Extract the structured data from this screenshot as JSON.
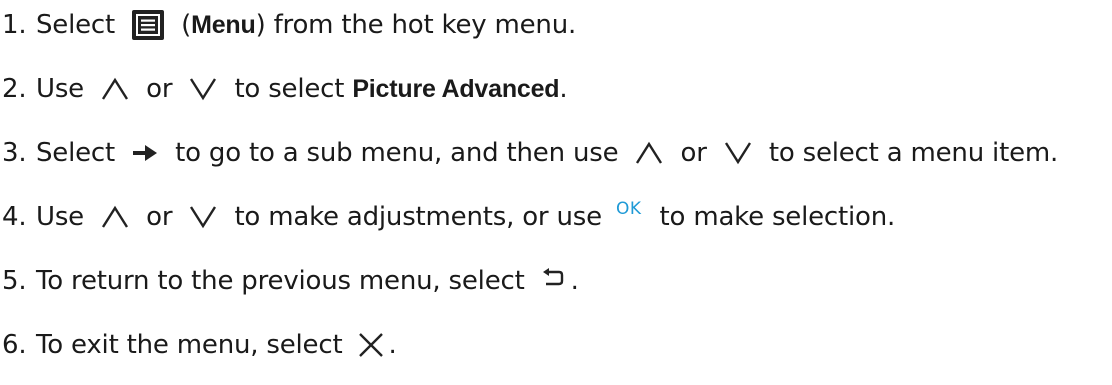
{
  "steps": [
    {
      "number": "1.",
      "parts": {
        "a": "Select ",
        "icon1": "menu-icon",
        "b": " (",
        "bold": "Menu",
        "c": ") from the hot key menu."
      }
    },
    {
      "number": "2.",
      "parts": {
        "a": "Use ",
        "icon1": "up-arrow-icon",
        "b": " or ",
        "icon2": "down-arrow-icon",
        "c": " to select ",
        "bold": "Picture Advanced",
        "d": "."
      }
    },
    {
      "number": "3.",
      "parts": {
        "a": "Select ",
        "icon1": "right-arrow-icon",
        "b": " to go to a sub menu, and then use ",
        "icon2": "up-arrow-icon",
        "c": " or ",
        "icon3": "down-arrow-icon",
        "d": " to select a menu item."
      }
    },
    {
      "number": "4.",
      "parts": {
        "a": "Use ",
        "icon1": "up-arrow-icon",
        "b": " or ",
        "icon2": "down-arrow-icon",
        "c": " to make adjustments, or use ",
        "ok_label": "OK",
        "d": " to make selection."
      }
    },
    {
      "number": "5.",
      "parts": {
        "a": "To return to the previous menu, select ",
        "icon1": "back-icon",
        "b": "."
      }
    },
    {
      "number": "6.",
      "parts": {
        "a": "To exit the menu, select ",
        "icon1": "close-icon",
        "b": "."
      }
    }
  ],
  "colors": {
    "text": "#1a1a1a",
    "ok_accent": "#1f9ad6"
  }
}
